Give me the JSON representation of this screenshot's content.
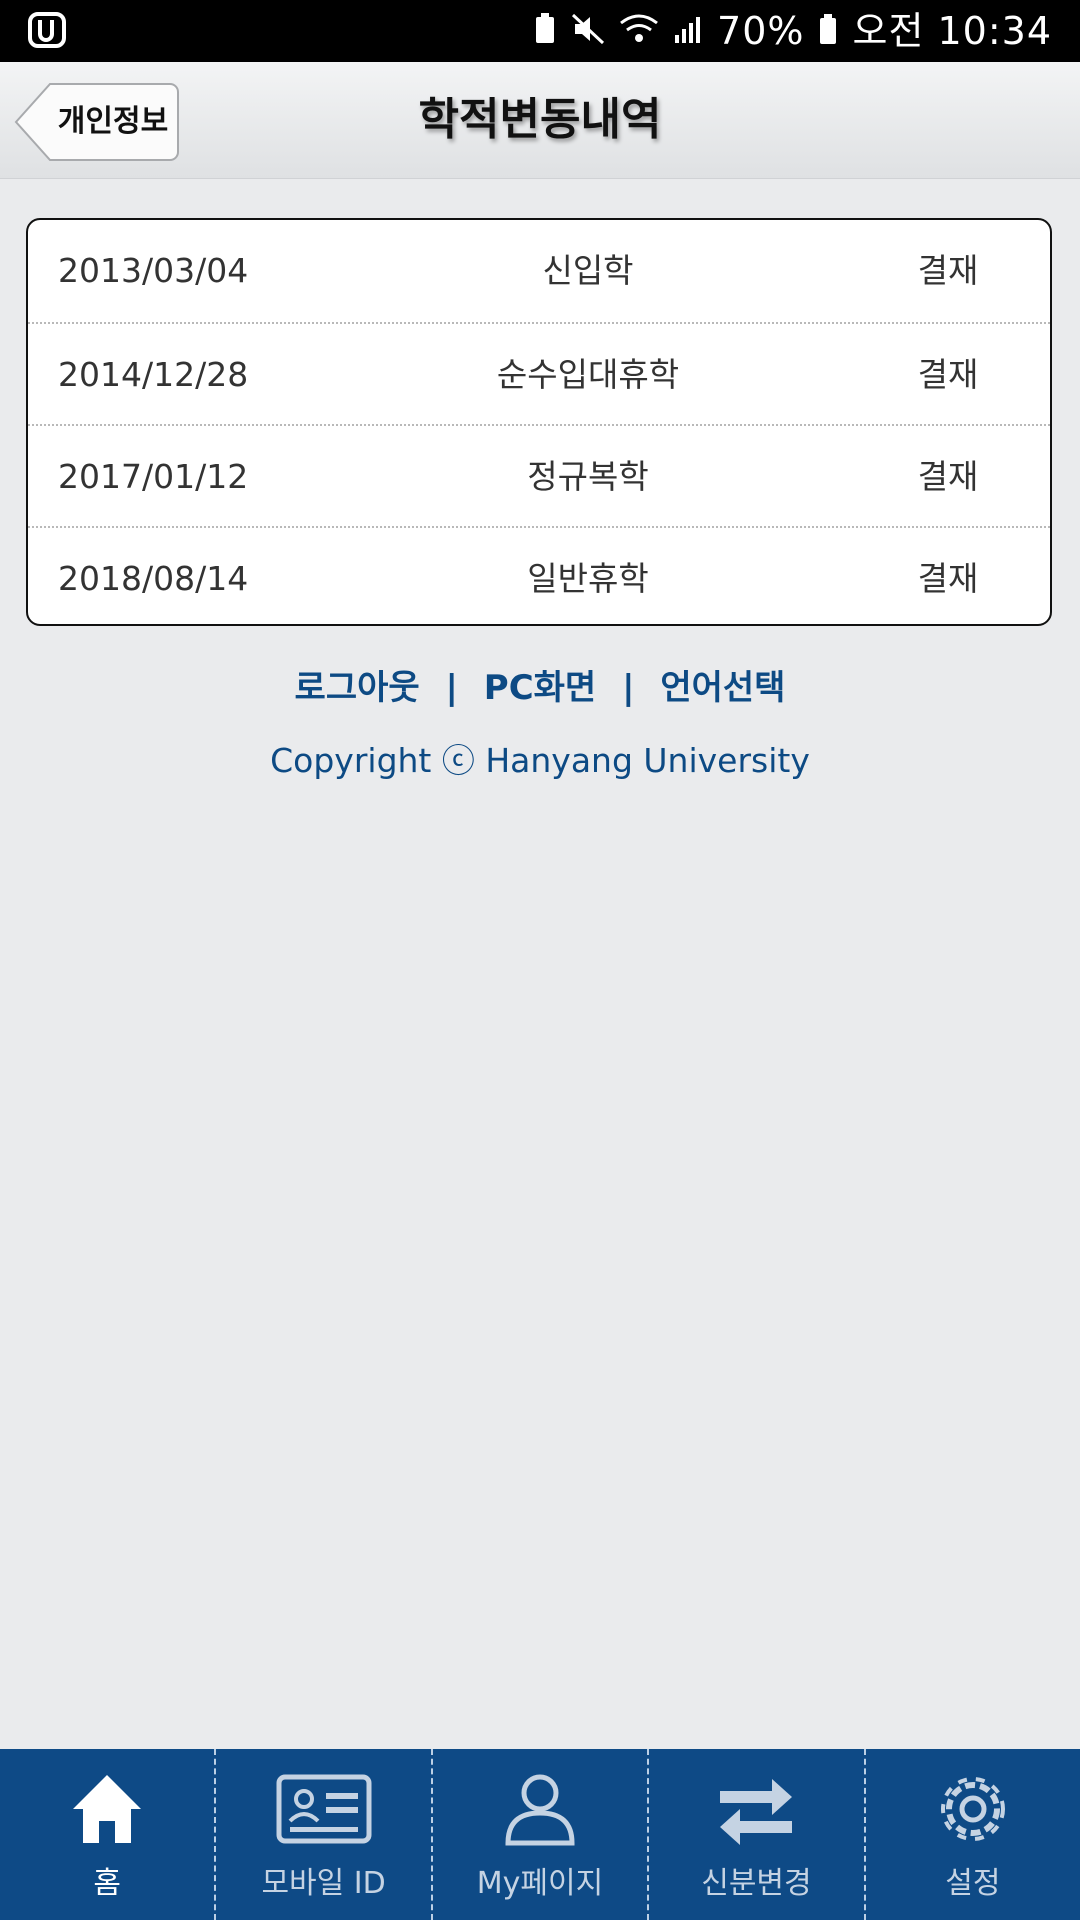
{
  "status_bar": {
    "battery": "70%",
    "time": "오전 10:34"
  },
  "header": {
    "back_label": "개인정보",
    "title": "학적변동내역"
  },
  "records": [
    {
      "date": "2013/03/04",
      "type": "신입학",
      "status": "결재"
    },
    {
      "date": "2014/12/28",
      "type": "순수입대휴학",
      "status": "결재"
    },
    {
      "date": "2017/01/12",
      "type": "정규복학",
      "status": "결재"
    },
    {
      "date": "2018/08/14",
      "type": "일반휴학",
      "status": "결재"
    }
  ],
  "footer": {
    "logout": "로그아웃",
    "pc_view": "PC화면",
    "language": "언어선택",
    "separator": "|",
    "copyright": "Copyright ⓒ Hanyang University"
  },
  "bottom_nav": [
    {
      "label": "홈",
      "icon": "home-icon"
    },
    {
      "label": "모바일 ID",
      "icon": "id-card-icon"
    },
    {
      "label": "My페이지",
      "icon": "person-icon"
    },
    {
      "label": "신분변경",
      "icon": "swap-arrows-icon"
    },
    {
      "label": "설정",
      "icon": "gear-icon"
    }
  ],
  "colors": {
    "nav_background": "#0e4a86",
    "link": "#0d4a84",
    "page_background": "#eaebed"
  }
}
